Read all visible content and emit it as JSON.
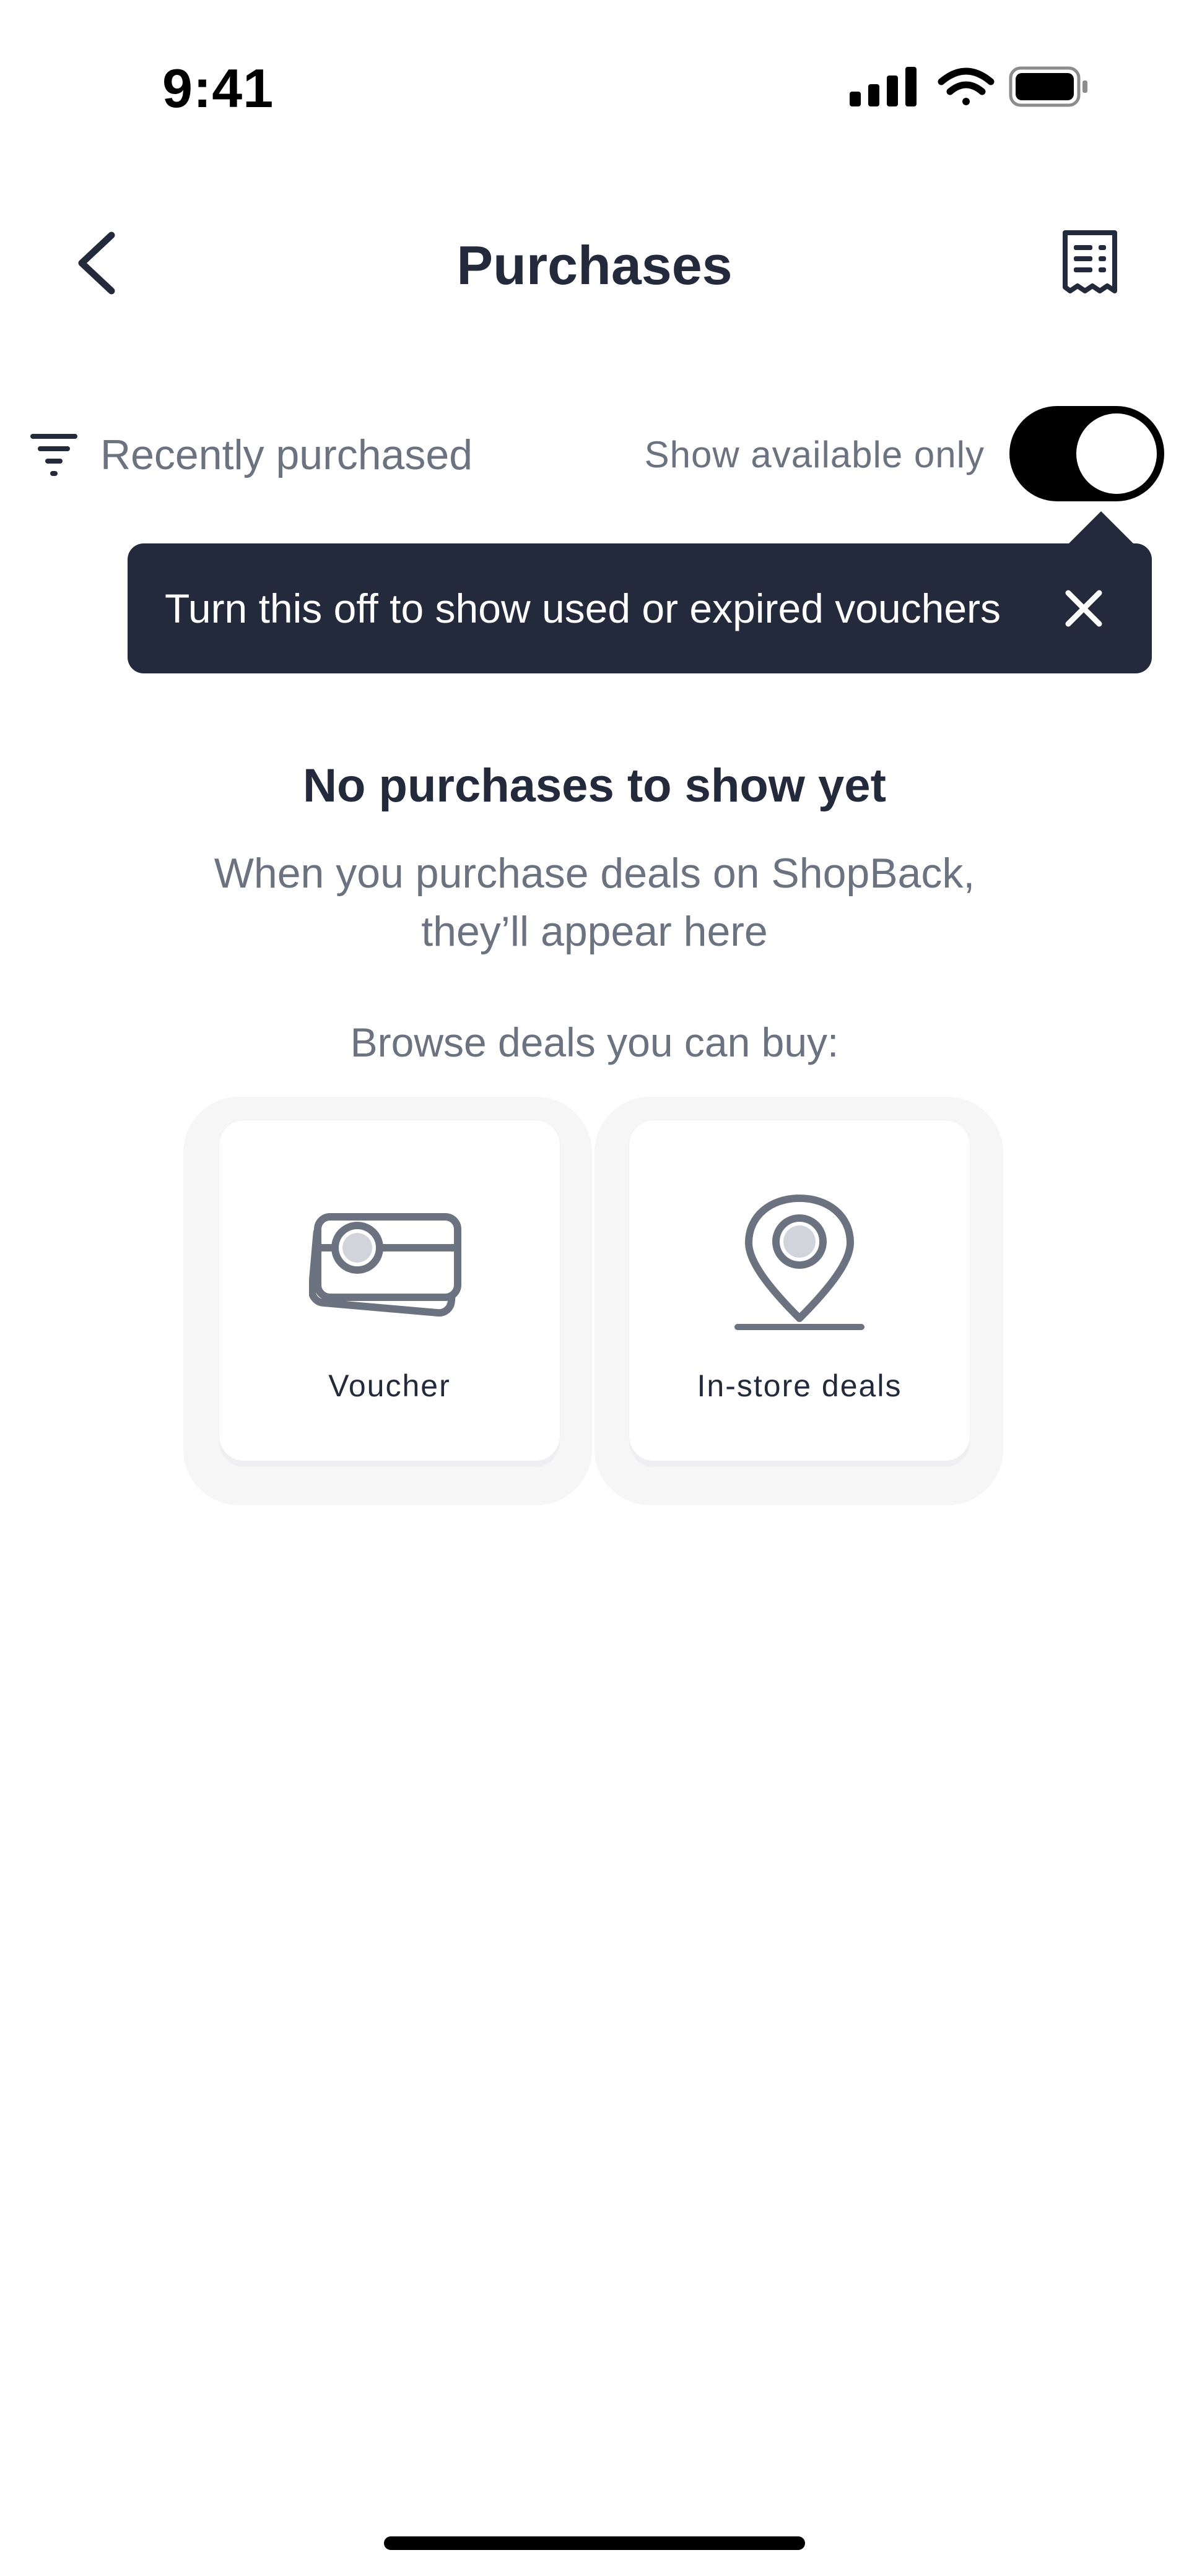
{
  "status_bar": {
    "time": "9:41"
  },
  "header": {
    "title": "Purchases"
  },
  "filters": {
    "sort_label": "Recently purchased",
    "toggle_label": "Show available only",
    "toggle_on": true
  },
  "tooltip": {
    "text": "Turn this off to show used or expired vouchers"
  },
  "empty_state": {
    "title": "No purchases to show yet",
    "description": "When you purchase deals on ShopBack, they’ll appear here",
    "browse_label": "Browse deals you can buy:"
  },
  "categories": [
    {
      "label": "Voucher",
      "icon": "voucher-icon"
    },
    {
      "label": "In-store deals",
      "icon": "location-pin-icon"
    }
  ],
  "colors": {
    "text_primary": "#232a3b",
    "text_secondary": "#6b7280",
    "tooltip_bg": "#232a3b",
    "toggle_on": "#000000"
  }
}
